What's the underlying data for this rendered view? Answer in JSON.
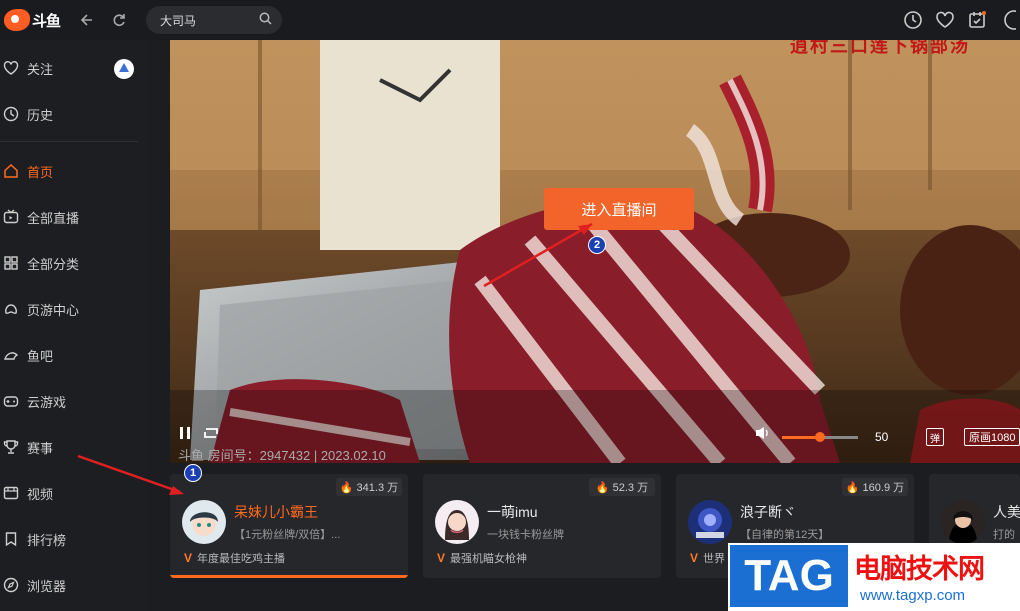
{
  "topbar": {
    "logo_text": "斗鱼",
    "search_value": "大司马"
  },
  "sidebar": {
    "items": [
      {
        "label": "关注",
        "icon": "heart-icon"
      },
      {
        "label": "历史",
        "icon": "clock-icon"
      },
      {
        "label": "首页",
        "icon": "home-icon",
        "active": true
      },
      {
        "label": "全部直播",
        "icon": "tv-icon"
      },
      {
        "label": "全部分类",
        "icon": "grid-icon"
      },
      {
        "label": "页游中心",
        "icon": "gamepad-icon"
      },
      {
        "label": "鱼吧",
        "icon": "fish-icon"
      },
      {
        "label": "云游戏",
        "icon": "controller-icon"
      },
      {
        "label": "赛事",
        "icon": "trophy-icon"
      },
      {
        "label": "视频",
        "icon": "video-icon"
      },
      {
        "label": "排行榜",
        "icon": "bookmark-icon"
      },
      {
        "label": "浏览器",
        "icon": "compass-icon"
      }
    ]
  },
  "video": {
    "enter_label": "进入直播间",
    "overlay_text": "逍村三口莲下锅部汤",
    "room_meta": "斗鱼 房间号：2947432 | 2023.02.10",
    "volume_value": "50",
    "volume_level": 0.5,
    "danmu_label": "弹",
    "quality_label": "原画1080"
  },
  "cards": [
    {
      "name": "呆妹儿小霸王",
      "sub": "【1元粉丝牌/双倍】...",
      "hot": "341.3 万",
      "tag": "年度最佳吃鸡主播",
      "highlight": true
    },
    {
      "name": "一萌imu",
      "sub": "一块钱卡粉丝牌",
      "hot": "52.3 万",
      "tag": "最强机瞄女枪神",
      "highlight": false
    },
    {
      "name": "浪子断ヾ",
      "sub": "【自律的第12天】",
      "hot": "160.9 万",
      "tag": "世界",
      "highlight": false
    },
    {
      "name": "人美",
      "sub": "打的",
      "hot": "",
      "tag": "",
      "highlight": false
    }
  ],
  "annotations": [
    "1",
    "2"
  ],
  "watermark": {
    "tag": "TAG",
    "cn": "电脑技术网",
    "url": "www.tagxp.com"
  },
  "colors": {
    "accent": "#ff6a1f",
    "bg": "#18191c",
    "annotation": "#1d3fb4",
    "arrow": "#e02020"
  }
}
